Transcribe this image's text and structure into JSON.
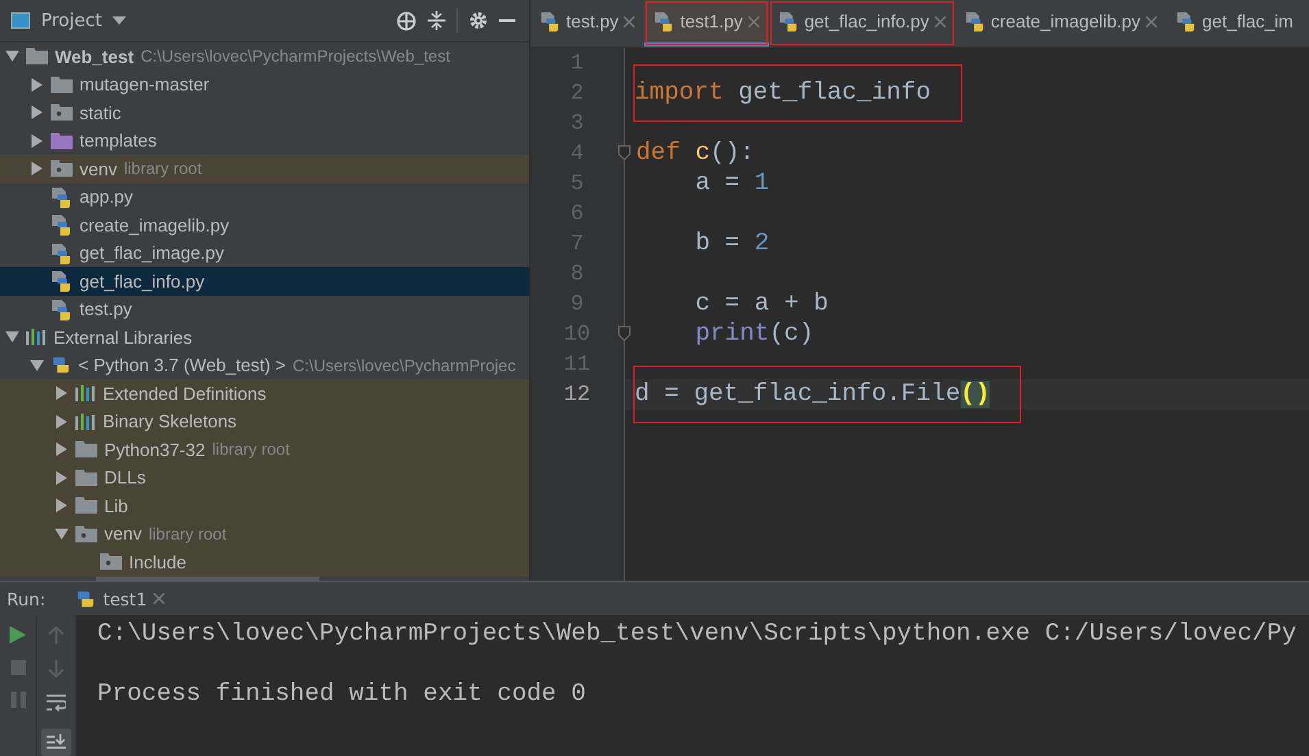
{
  "project_panel": {
    "title": "Project"
  },
  "tree": [
    {
      "label": "Web_test",
      "hint": "C:\\Users\\lovec\\PycharmProjects\\Web_test",
      "kind": "root",
      "expanded": true,
      "selected": false,
      "library": false,
      "children": [
        {
          "label": "mutagen-master",
          "kind": "folder",
          "expanded": false,
          "selected": false,
          "library": false
        },
        {
          "label": "static",
          "kind": "source-folder",
          "expanded": false,
          "selected": false,
          "library": false
        },
        {
          "label": "templates",
          "kind": "template-folder",
          "expanded": false,
          "selected": false,
          "library": false
        },
        {
          "label": "venv",
          "hint": "library root",
          "kind": "source-folder",
          "expanded": false,
          "selected": false,
          "library": true
        },
        {
          "label": "app.py",
          "kind": "py",
          "selected": false,
          "library": false
        },
        {
          "label": "create_imagelib.py",
          "kind": "py",
          "selected": false,
          "library": false
        },
        {
          "label": "get_flac_image.py",
          "kind": "py",
          "selected": false,
          "library": false
        },
        {
          "label": "get_flac_info.py",
          "kind": "py",
          "selected": true,
          "library": false
        },
        {
          "label": "test.py",
          "kind": "py",
          "selected": false,
          "library": false
        }
      ]
    },
    {
      "label": "External Libraries",
      "kind": "libraries",
      "expanded": true,
      "selected": false,
      "library": false,
      "children": [
        {
          "label": "< Python 3.7 (Web_test) >",
          "hint": "C:\\Users\\lovec\\PycharmProjec",
          "kind": "python",
          "expanded": true,
          "selected": false,
          "library": false,
          "children": [
            {
              "label": "Extended Definitions",
              "kind": "libraries",
              "expanded": false,
              "selected": false,
              "library": true
            },
            {
              "label": "Binary Skeletons",
              "kind": "libraries",
              "expanded": false,
              "selected": false,
              "library": true
            },
            {
              "label": "Python37-32",
              "hint": "library root",
              "kind": "folder",
              "expanded": false,
              "selected": false,
              "library": true
            },
            {
              "label": "DLLs",
              "kind": "folder",
              "expanded": false,
              "selected": false,
              "library": true
            },
            {
              "label": "Lib",
              "kind": "folder",
              "expanded": false,
              "selected": false,
              "library": true
            },
            {
              "label": "venv",
              "hint": "library root",
              "kind": "source-folder",
              "expanded": true,
              "selected": false,
              "library": true,
              "children": [
                {
                  "label": "Include",
                  "kind": "source-folder",
                  "selected": false,
                  "library": true
                }
              ]
            }
          ]
        }
      ]
    }
  ],
  "tabs": [
    {
      "label": "test.py",
      "selected": false,
      "annotated": false
    },
    {
      "label": "test1.py",
      "selected": true,
      "annotated": true
    },
    {
      "label": "get_flac_info.py",
      "selected": false,
      "annotated": true
    },
    {
      "label": "create_imagelib.py",
      "selected": false,
      "annotated": false
    },
    {
      "label": "get_flac_im",
      "selected": false,
      "annotated": false
    }
  ],
  "code": [
    {
      "number": "1",
      "current": false,
      "annotated": false,
      "fold": false
    },
    {
      "number": "2",
      "current": false,
      "annotated": true,
      "fold": false,
      "tokens": [
        {
          "text": "import",
          "kind": "keyword"
        },
        {
          "text": " get_flac_info",
          "kind": "plain"
        }
      ]
    },
    {
      "number": "3",
      "current": false,
      "annotated": false,
      "fold": false
    },
    {
      "number": "4",
      "current": false,
      "annotated": false,
      "fold": true,
      "tokens": [
        {
          "text": "def",
          "kind": "keyword"
        },
        {
          "text": " c",
          "kind": "function"
        },
        {
          "text": "():",
          "kind": "plain"
        }
      ]
    },
    {
      "number": "5",
      "current": false,
      "annotated": false,
      "fold": false,
      "tokens": [
        {
          "text": "    a = ",
          "kind": "plain"
        },
        {
          "text": "1",
          "kind": "number"
        }
      ]
    },
    {
      "number": "6",
      "current": false,
      "annotated": false,
      "fold": false
    },
    {
      "number": "7",
      "current": false,
      "annotated": false,
      "fold": false,
      "tokens": [
        {
          "text": "    b = ",
          "kind": "plain"
        },
        {
          "text": "2",
          "kind": "number"
        }
      ]
    },
    {
      "number": "8",
      "current": false,
      "annotated": false,
      "fold": false
    },
    {
      "number": "9",
      "current": false,
      "annotated": false,
      "fold": false,
      "tokens": [
        {
          "text": "    c = a + b",
          "kind": "plain"
        }
      ]
    },
    {
      "number": "10",
      "current": false,
      "annotated": false,
      "fold": true,
      "tokens": [
        {
          "text": "    print",
          "kind": "builtin"
        },
        {
          "text": "(c)",
          "kind": "plain"
        }
      ]
    },
    {
      "number": "11",
      "current": false,
      "annotated": false,
      "fold": false
    },
    {
      "number": "12",
      "current": true,
      "annotated": true,
      "fold": false,
      "tokens": [
        {
          "text": "d = get_flac_info.File",
          "kind": "plain"
        },
        {
          "text": "()",
          "kind": "brace-match"
        }
      ]
    }
  ],
  "run": {
    "label": "Run:",
    "tab": "test1",
    "output": [
      "C:\\Users\\lovec\\PycharmProjects\\Web_test\\venv\\Scripts\\python.exe C:/Users/lovec/Py",
      "Process finished with exit code 0"
    ]
  }
}
